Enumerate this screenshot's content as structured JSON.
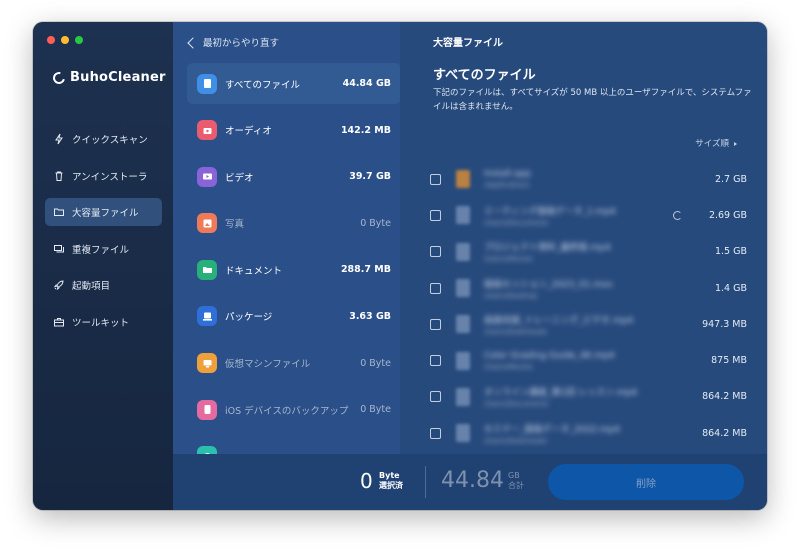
{
  "window": {
    "traffic_colors": [
      "#ff5f57",
      "#febc2e",
      "#28c840"
    ]
  },
  "app": {
    "name": "BuhoCleaner"
  },
  "sidebar": {
    "items": [
      {
        "label": "クイックスキャン",
        "icon": "quick-scan-icon",
        "active": false
      },
      {
        "label": "アンインストーラ",
        "icon": "trash-icon",
        "active": false
      },
      {
        "label": "大容量ファイル",
        "icon": "folder-icon",
        "active": true
      },
      {
        "label": "重複ファイル",
        "icon": "duplicate-icon",
        "active": false
      },
      {
        "label": "起動項目",
        "icon": "rocket-icon",
        "active": false
      },
      {
        "label": "ツールキット",
        "icon": "toolkit-icon",
        "active": false
      }
    ]
  },
  "categories_panel": {
    "back_label": "最初からやり直す",
    "items": [
      {
        "name": "すべてのファイル",
        "size": "44.84 GB",
        "icon": "all-files-icon",
        "color": "#3f8fe6",
        "active": true,
        "dim": false
      },
      {
        "name": "オーディオ",
        "size": "142.2 MB",
        "icon": "audio-icon",
        "color": "#ea5b6e",
        "active": false,
        "dim": false
      },
      {
        "name": "ビデオ",
        "size": "39.7 GB",
        "icon": "video-icon",
        "color": "#8a63d9",
        "active": false,
        "dim": false
      },
      {
        "name": "写真",
        "size": "0 Byte",
        "icon": "photo-icon",
        "color": "#ee7a5a",
        "active": false,
        "dim": true
      },
      {
        "name": "ドキュメント",
        "size": "288.7 MB",
        "icon": "document-icon",
        "color": "#27b07a",
        "active": false,
        "dim": false
      },
      {
        "name": "パッケージ",
        "size": "3.63 GB",
        "icon": "package-icon",
        "color": "#2f6fd8",
        "active": false,
        "dim": false
      },
      {
        "name": "仮想マシンファイル",
        "size": "0 Byte",
        "icon": "vm-icon",
        "color": "#eea13a",
        "active": false,
        "dim": true
      },
      {
        "name": "iOS デバイスのバックアップ",
        "size": "0 Byte",
        "icon": "ios-backup-icon",
        "color": "#e56aa0",
        "active": false,
        "dim": true
      },
      {
        "name": "",
        "size": "",
        "icon": "other-icon",
        "color": "#2bbfae",
        "active": false,
        "dim": true
      }
    ]
  },
  "files_panel": {
    "header": "大容量ファイル",
    "title": "すべてのファイル",
    "description": "下記のファイルは、すべてサイズが 50 MB 以上のユーザファイルで、システムファイルは含まれません。",
    "sort_label": "サイズ順",
    "rows": [
      {
        "name": "Install.app",
        "path": "/Applications",
        "size": "2.7 GB",
        "thumb": "orange",
        "spinner": false
      },
      {
        "name": "ミーティング録画データ_1.mp4",
        "path": "/Users/Documents",
        "size": "2.69 GB",
        "thumb": "doc",
        "spinner": true
      },
      {
        "name": "プロジェクト資料_最終版.mp4",
        "path": "/Users/Movies",
        "size": "1.5 GB",
        "thumb": "doc",
        "spinner": false
      },
      {
        "name": "録画セッション_2023_01.mov",
        "path": "/Users/Desktop",
        "size": "1.4 GB",
        "thumb": "doc",
        "spinner": false
      },
      {
        "name": "画面収録_トレーニング_ビデオ.mp4",
        "path": "/Users/Downloads",
        "size": "947.3 MB",
        "thumb": "doc",
        "spinner": false
      },
      {
        "name": "Color Grading Guide_4K.mp4",
        "path": "/Users/Movies",
        "size": "875 MB",
        "thumb": "doc",
        "spinner": false
      },
      {
        "name": "オンライン講座_第1回 レッスン.mp4",
        "path": "/Users/Documents",
        "size": "864.2 MB",
        "thumb": "doc",
        "spinner": false
      },
      {
        "name": "セミナー_録画データ_2022.mp4",
        "path": "/Users/Downloads",
        "size": "864.2 MB",
        "thumb": "doc",
        "spinner": false
      }
    ]
  },
  "footer": {
    "selected_value": "0",
    "selected_unit": "Byte",
    "selected_label": "選択済",
    "total_value": "44.84",
    "total_unit": "GB",
    "total_label": "合計",
    "delete_label": "削除"
  }
}
